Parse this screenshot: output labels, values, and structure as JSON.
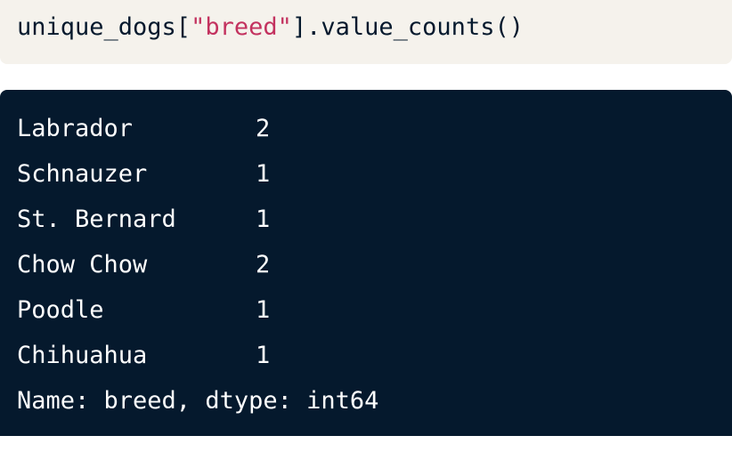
{
  "code_cell": {
    "prefix": "unique_dogs[",
    "string_literal": "\"breed\"",
    "suffix": "].value_counts()",
    "colors": {
      "background": "#f5f2ec",
      "text": "#05192d",
      "string": "#c3325f"
    }
  },
  "output_cell": {
    "background": "#05192d",
    "text_color": "#ffffff",
    "rows": [
      {
        "breed": "Labrador",
        "count": "2"
      },
      {
        "breed": "Schnauzer",
        "count": "1"
      },
      {
        "breed": "St. Bernard",
        "count": "1"
      },
      {
        "breed": "Chow Chow",
        "count": "2"
      },
      {
        "breed": "Poodle",
        "count": "1"
      },
      {
        "breed": "Chihuahua",
        "count": "1"
      }
    ],
    "footer": "Name: breed, dtype: int64"
  }
}
